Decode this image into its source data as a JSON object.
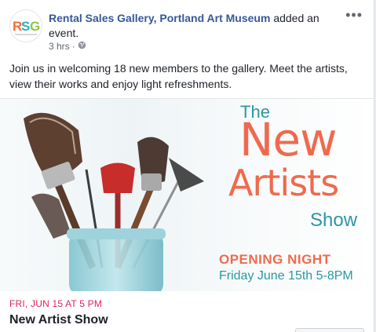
{
  "post": {
    "page_name": "Rental Sales Gallery, Portland Art Museum",
    "action_text": "added an event.",
    "time": "3 hrs",
    "separator": "·",
    "more_label": "•••",
    "body_text": "Join us in welcoming 18 new members to the gallery. Meet the artists, view their works and enjoy light refreshments."
  },
  "avatar": {
    "logo_text": "RSG",
    "colors": [
      "#f26b3a",
      "#2ab0c2",
      "#8cc63f"
    ]
  },
  "poster": {
    "the": "The",
    "new": "New",
    "artists": "Artists",
    "show": "Show",
    "opening": "OPENING NIGHT",
    "date": "Friday June 15th 5-8PM",
    "accent_orange": "#ef6a4d",
    "accent_teal": "#2b96a3"
  },
  "event": {
    "date_line": "FRI, JUN 15 AT 5 PM",
    "title": "New Artist Show"
  },
  "icons": {
    "globe": "globe-icon",
    "more": "more-options-icon"
  }
}
